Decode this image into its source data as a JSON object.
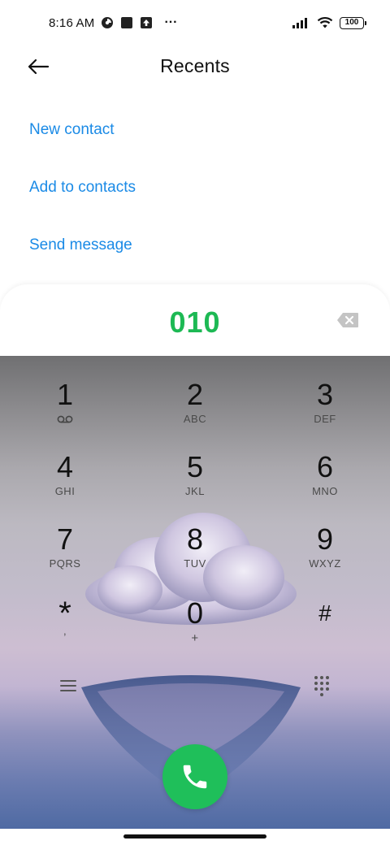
{
  "status_bar": {
    "time": "8:16 AM",
    "dots": "···",
    "battery": "100",
    "icons": [
      "data-saver-icon",
      "square-notification-icon",
      "upload-notification-icon",
      "signal-icon",
      "wifi-icon",
      "battery-icon"
    ]
  },
  "header": {
    "title": "Recents",
    "back_icon": "back-arrow-icon"
  },
  "actions": [
    {
      "label": "New contact"
    },
    {
      "label": "Add to contacts"
    },
    {
      "label": "Send message"
    }
  ],
  "dialer": {
    "number": "010",
    "backspace_icon": "backspace-icon",
    "keys": [
      {
        "digit": "1",
        "letters": "",
        "sub_icon": "voicemail-icon"
      },
      {
        "digit": "2",
        "letters": "ABC"
      },
      {
        "digit": "3",
        "letters": "DEF"
      },
      {
        "digit": "4",
        "letters": "GHI"
      },
      {
        "digit": "5",
        "letters": "JKL"
      },
      {
        "digit": "6",
        "letters": "MNO"
      },
      {
        "digit": "7",
        "letters": "PQRS"
      },
      {
        "digit": "8",
        "letters": "TUV"
      },
      {
        "digit": "9",
        "letters": "WXYZ"
      },
      {
        "digit": "*",
        "letters": ","
      },
      {
        "digit": "0",
        "letters": "+"
      },
      {
        "digit": "#",
        "letters": ""
      }
    ],
    "menu_icon": "menu-icon",
    "dialpad_icon": "dialpad-icon",
    "call_icon": "phone-icon"
  },
  "colors": {
    "accent_link": "#1a8ae6",
    "dialed_number": "#1db954",
    "call_button": "#1fbf5a"
  }
}
